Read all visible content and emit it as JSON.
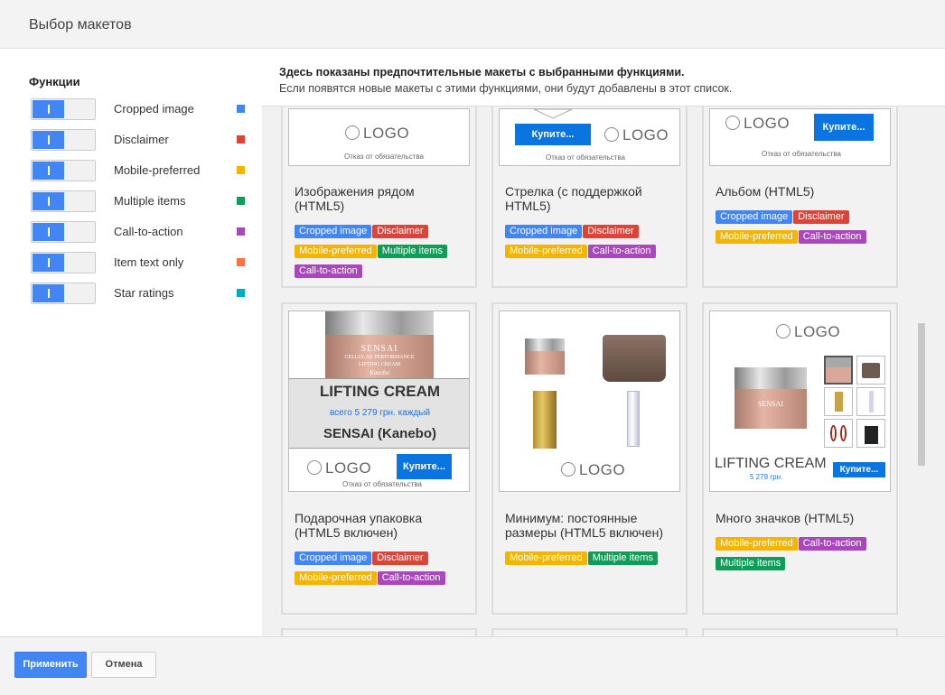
{
  "dialog": {
    "title": "Выбор макетов"
  },
  "sidebar": {
    "heading": "Функции",
    "features": [
      {
        "label": "Cropped image",
        "color": "#4285f4",
        "enabled": true
      },
      {
        "label": "Disclaimer",
        "color": "#db4437",
        "enabled": true
      },
      {
        "label": "Mobile-preferred",
        "color": "#f4b400",
        "enabled": true
      },
      {
        "label": "Multiple items",
        "color": "#0f9d58",
        "enabled": true
      },
      {
        "label": "Call-to-action",
        "color": "#ab47bc",
        "enabled": true
      },
      {
        "label": "Item text only",
        "color": "#ff7043",
        "enabled": true
      },
      {
        "label": "Star ratings",
        "color": "#00acc1",
        "enabled": true
      }
    ]
  },
  "banner": {
    "title": "Здесь показаны предпочтительные макеты с выбранными функциями.",
    "text": "Если появятся новые макеты с этими функциями, они будут добавлены в этот список."
  },
  "preview": {
    "logo": "LOGO",
    "disclaimer": "Отказ от обязательства",
    "buy": "Купите...",
    "product_title": "LIFTING CREAM",
    "price_each": "всего 5 279 грн. каждый",
    "brand": "SENSAI (Kanebo)",
    "price_short": "5 279 грн.",
    "jar_brand": "SENSAI",
    "jar_subtitle": "CELLULAR PERFORMANCE",
    "jar_product": "LIFTING CREAM",
    "jar_maker": "Kanebo"
  },
  "cards": [
    {
      "name": "Изображения рядом (HTML5)",
      "tags": [
        "Cropped image",
        "Disclaimer",
        "Mobile-preferred",
        "Multiple items",
        "Call-to-action"
      ]
    },
    {
      "name": "Стрелка (с поддержкой HTML5)",
      "tags": [
        "Cropped image",
        "Disclaimer",
        "Mobile-preferred",
        "Call-to-action"
      ]
    },
    {
      "name": "Альбом (HTML5)",
      "tags": [
        "Cropped image",
        "Disclaimer",
        "Mobile-preferred",
        "Call-to-action"
      ]
    },
    {
      "name": "Подарочная упаковка (HTML5 включен)",
      "tags": [
        "Cropped image",
        "Disclaimer",
        "Mobile-preferred",
        "Call-to-action"
      ]
    },
    {
      "name": "Минимум: постоянные размеры (HTML5 включен)",
      "tags": [
        "Mobile-preferred",
        "Multiple items"
      ]
    },
    {
      "name": "Много значков (HTML5)",
      "tags": [
        "Mobile-preferred",
        "Call-to-action",
        "Multiple items"
      ]
    }
  ],
  "footer": {
    "apply": "Применить",
    "cancel": "Отмена"
  }
}
